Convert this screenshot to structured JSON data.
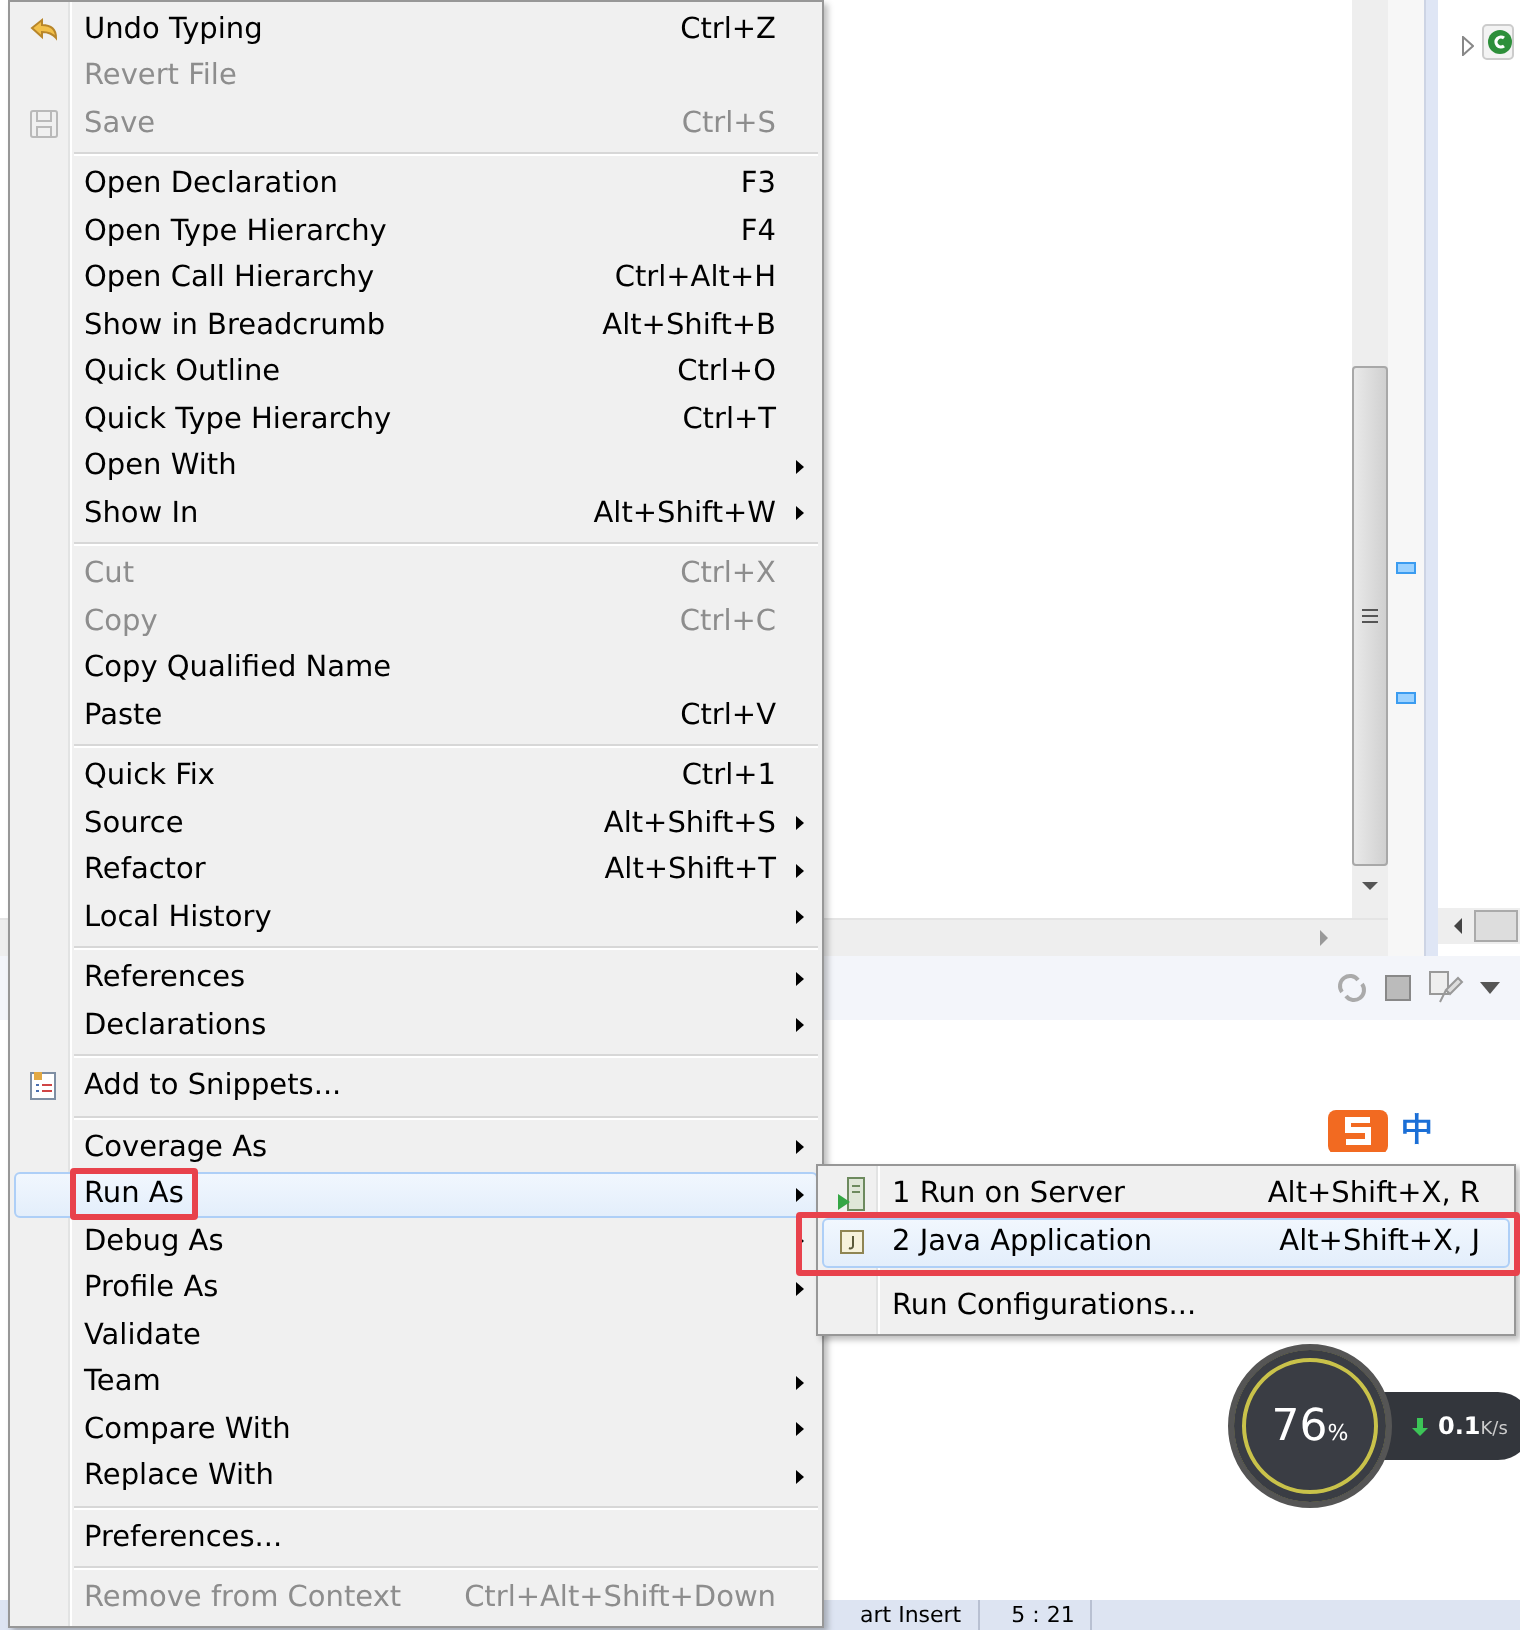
{
  "context_menu": {
    "items": [
      {
        "kind": "item",
        "label": "Undo Typing",
        "shortcut": "Ctrl+Z",
        "disabled": false,
        "submenu": false,
        "selected": false,
        "marked": false
      },
      {
        "kind": "item",
        "label": "Revert File",
        "disabled": true,
        "submenu": false,
        "selected": false,
        "marked": false
      },
      {
        "kind": "item",
        "label": "Save",
        "shortcut": "Ctrl+S",
        "disabled": true,
        "submenu": false,
        "selected": false,
        "marked": false
      },
      {
        "kind": "separator"
      },
      {
        "kind": "item",
        "label": "Open Declaration",
        "shortcut": "F3",
        "disabled": false,
        "submenu": false,
        "selected": false,
        "marked": false
      },
      {
        "kind": "item",
        "label": "Open Type Hierarchy",
        "shortcut": "F4",
        "disabled": false,
        "submenu": false,
        "selected": false,
        "marked": false
      },
      {
        "kind": "item",
        "label": "Open Call Hierarchy",
        "shortcut": "Ctrl+Alt+H",
        "disabled": false,
        "submenu": false,
        "selected": false,
        "marked": false
      },
      {
        "kind": "item",
        "label": "Show in Breadcrumb",
        "shortcut": "Alt+Shift+B",
        "disabled": false,
        "submenu": false,
        "selected": false,
        "marked": false
      },
      {
        "kind": "item",
        "label": "Quick Outline",
        "shortcut": "Ctrl+O",
        "disabled": false,
        "submenu": false,
        "selected": false,
        "marked": false
      },
      {
        "kind": "item",
        "label": "Quick Type Hierarchy",
        "shortcut": "Ctrl+T",
        "disabled": false,
        "submenu": false,
        "selected": false,
        "marked": false
      },
      {
        "kind": "item",
        "label": "Open With",
        "disabled": false,
        "submenu": true,
        "selected": false,
        "marked": false
      },
      {
        "kind": "item",
        "label": "Show In",
        "shortcut": "Alt+Shift+W",
        "disabled": false,
        "submenu": true,
        "selected": false,
        "marked": false
      },
      {
        "kind": "separator"
      },
      {
        "kind": "item",
        "label": "Cut",
        "shortcut": "Ctrl+X",
        "disabled": true,
        "submenu": false,
        "selected": false,
        "marked": false
      },
      {
        "kind": "item",
        "label": "Copy",
        "shortcut": "Ctrl+C",
        "disabled": true,
        "submenu": false,
        "selected": false,
        "marked": false
      },
      {
        "kind": "item",
        "label": "Copy Qualified Name",
        "disabled": false,
        "submenu": false,
        "selected": false,
        "marked": false
      },
      {
        "kind": "item",
        "label": "Paste",
        "shortcut": "Ctrl+V",
        "disabled": false,
        "submenu": false,
        "selected": false,
        "marked": false
      },
      {
        "kind": "separator"
      },
      {
        "kind": "item",
        "label": "Quick Fix",
        "shortcut": "Ctrl+1",
        "disabled": false,
        "submenu": false,
        "selected": false,
        "marked": false
      },
      {
        "kind": "item",
        "label": "Source",
        "shortcut": "Alt+Shift+S",
        "disabled": false,
        "submenu": true,
        "selected": false,
        "marked": false
      },
      {
        "kind": "item",
        "label": "Refactor",
        "shortcut": "Alt+Shift+T",
        "disabled": false,
        "submenu": true,
        "selected": false,
        "marked": false
      },
      {
        "kind": "item",
        "label": "Local History",
        "disabled": false,
        "submenu": true,
        "selected": false,
        "marked": false
      },
      {
        "kind": "separator"
      },
      {
        "kind": "item",
        "label": "References",
        "disabled": false,
        "submenu": true,
        "selected": false,
        "marked": false
      },
      {
        "kind": "item",
        "label": "Declarations",
        "disabled": false,
        "submenu": true,
        "selected": false,
        "marked": false
      },
      {
        "kind": "separator"
      },
      {
        "kind": "item",
        "label": "Add to Snippets...",
        "disabled": false,
        "submenu": false,
        "selected": false,
        "marked": false
      },
      {
        "kind": "separator"
      },
      {
        "kind": "item",
        "label": "Coverage As",
        "disabled": false,
        "submenu": true,
        "selected": false,
        "marked": false
      },
      {
        "kind": "item",
        "label": "Run As",
        "disabled": false,
        "submenu": true,
        "selected": true,
        "marked": true,
        "submenu_items": [
          {
            "kind": "item",
            "label": "1 Run on Server",
            "shortcut": "Alt+Shift+X, R",
            "selected": false,
            "marked": false
          },
          {
            "kind": "item",
            "label": "2 Java Application",
            "shortcut": "Alt+Shift+X, J",
            "selected": true,
            "marked": true
          },
          {
            "kind": "separator"
          },
          {
            "kind": "item",
            "label": "Run Configurations...",
            "selected": false,
            "marked": false
          }
        ]
      },
      {
        "kind": "item",
        "label": "Debug As",
        "disabled": false,
        "submenu": true,
        "selected": false,
        "marked": false
      },
      {
        "kind": "item",
        "label": "Profile As",
        "disabled": false,
        "submenu": true,
        "selected": false,
        "marked": false
      },
      {
        "kind": "item",
        "label": "Validate",
        "disabled": false,
        "submenu": false,
        "selected": false,
        "marked": false
      },
      {
        "kind": "item",
        "label": "Team",
        "disabled": false,
        "submenu": true,
        "selected": false,
        "marked": false
      },
      {
        "kind": "item",
        "label": "Compare With",
        "disabled": false,
        "submenu": true,
        "selected": false,
        "marked": false
      },
      {
        "kind": "item",
        "label": "Replace With",
        "disabled": false,
        "submenu": true,
        "selected": false,
        "marked": false
      },
      {
        "kind": "separator"
      },
      {
        "kind": "item",
        "label": "Preferences...",
        "disabled": false,
        "submenu": false,
        "selected": false,
        "marked": false
      },
      {
        "kind": "separator"
      },
      {
        "kind": "item",
        "label": "Remove from Context",
        "shortcut": "Ctrl+Alt+Shift+Down",
        "disabled": true,
        "submenu": false,
        "selected": false,
        "marked": false
      }
    ]
  },
  "input_method_bar": {
    "label": "中"
  },
  "system_monitor": {
    "percent": "76",
    "percent_unit": "%",
    "speed": "0.1",
    "speed_unit": "K/s"
  },
  "status_bar": [
    "art Insert",
    "5 : 21"
  ]
}
